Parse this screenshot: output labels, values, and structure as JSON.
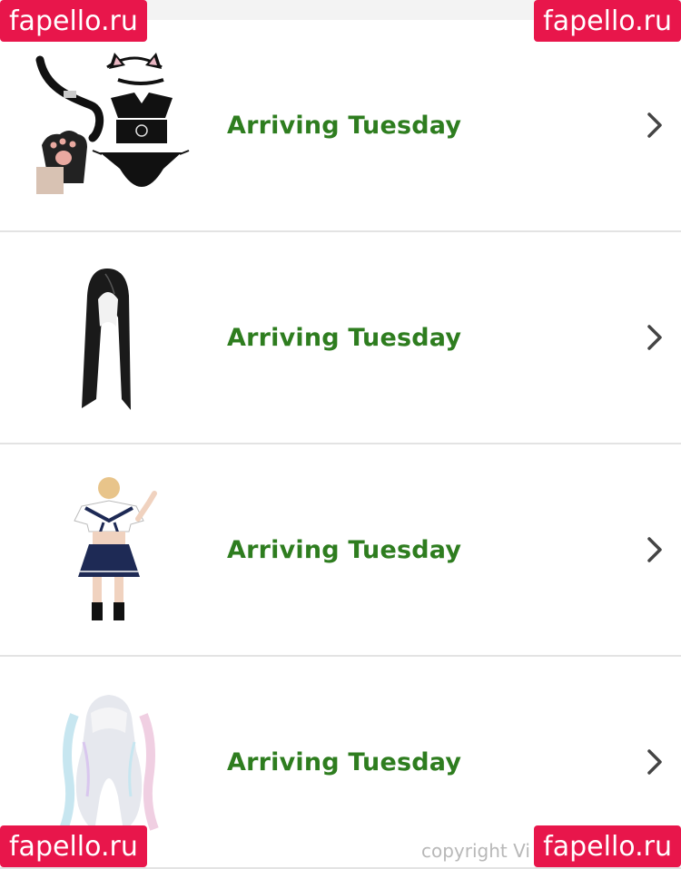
{
  "orders": [
    {
      "status": "Arriving Tuesday",
      "image": "cat-costume-set-image"
    },
    {
      "status": "Arriving Tuesday",
      "image": "black-long-wig-image"
    },
    {
      "status": "Arriving Tuesday",
      "image": "sailor-uniform-image"
    },
    {
      "status": "Arriving Tuesday",
      "image": "pastel-wig-image"
    }
  ],
  "watermark": "fapello.ru",
  "footer": {
    "copyright": "copyright Vi"
  },
  "colors": {
    "status": "#2e7d1f",
    "watermark_bg": "#e8164b",
    "divider": "#e3e3e3"
  },
  "icons": {
    "chevron": "chevron-right-icon"
  }
}
